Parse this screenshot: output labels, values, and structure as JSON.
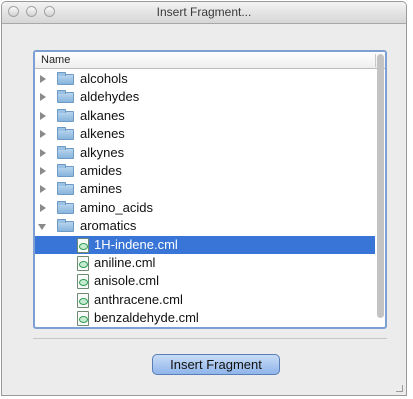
{
  "window": {
    "title": "Insert Fragment..."
  },
  "tree": {
    "column_header": "Name",
    "items": [
      {
        "label": "alcohols",
        "kind": "folder",
        "state": "collapsed",
        "icon": "folder-icon"
      },
      {
        "label": "aldehydes",
        "kind": "folder",
        "state": "collapsed",
        "icon": "folder-icon"
      },
      {
        "label": "alkanes",
        "kind": "folder",
        "state": "collapsed",
        "icon": "folder-icon"
      },
      {
        "label": "alkenes",
        "kind": "folder",
        "state": "collapsed",
        "icon": "folder-icon"
      },
      {
        "label": "alkynes",
        "kind": "folder",
        "state": "collapsed",
        "icon": "folder-icon"
      },
      {
        "label": "amides",
        "kind": "folder",
        "state": "collapsed",
        "icon": "folder-icon"
      },
      {
        "label": "amines",
        "kind": "folder",
        "state": "collapsed",
        "icon": "folder-icon"
      },
      {
        "label": "amino_acids",
        "kind": "folder",
        "state": "collapsed",
        "icon": "folder-icon"
      },
      {
        "label": "aromatics",
        "kind": "folder",
        "state": "expanded",
        "icon": "folder-icon"
      },
      {
        "label": "1H-indene.cml",
        "kind": "file",
        "selected": true,
        "icon": "cml-file-icon"
      },
      {
        "label": "aniline.cml",
        "kind": "file",
        "icon": "cml-file-icon"
      },
      {
        "label": "anisole.cml",
        "kind": "file",
        "icon": "cml-file-icon"
      },
      {
        "label": "anthracene.cml",
        "kind": "file",
        "icon": "cml-file-icon"
      },
      {
        "label": "benzaldehyde.cml",
        "kind": "file",
        "icon": "cml-file-icon"
      }
    ]
  },
  "footer": {
    "insert_button_label": "Insert Fragment"
  },
  "colors": {
    "selection": "#3875d7",
    "focus_ring": "#7c9fd4",
    "button_fill": "#a9c8f0",
    "window_bg": "#ececec"
  }
}
